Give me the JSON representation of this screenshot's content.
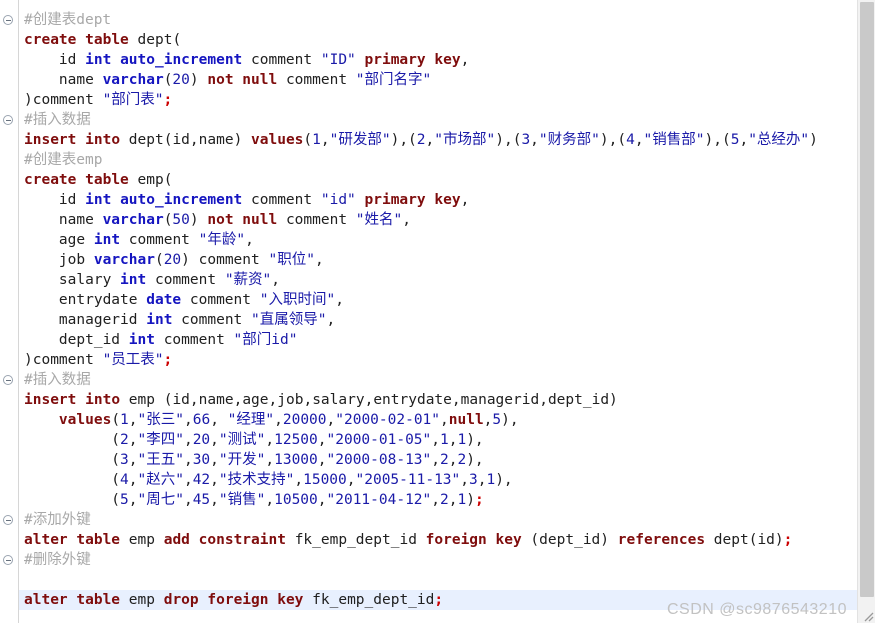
{
  "editor": {
    "language": "sql",
    "highlighted_line_index": 29,
    "colors": {
      "keyword": "#7f0d0d",
      "type": "#1515c0",
      "string": "#1a1aa8",
      "number": "#1a1aa8",
      "semicolon": "#cc0000",
      "comment": "#a8a8a8",
      "plain": "#202020",
      "current_line_bg": "#e8f0fe",
      "background": "#ffffff"
    }
  },
  "lines": [
    {
      "fold": true,
      "text": "#创建表dept"
    },
    {
      "fold": false,
      "text": "create table dept("
    },
    {
      "fold": false,
      "text": "    id int auto_increment comment \"ID\" primary key,"
    },
    {
      "fold": false,
      "text": "    name varchar(20) not null comment \"部门名字\""
    },
    {
      "fold": false,
      "text": ")comment \"部门表\";"
    },
    {
      "fold": true,
      "text": "#插入数据"
    },
    {
      "fold": false,
      "text": "insert into dept(id,name) values(1,\"研发部\"),(2,\"市场部\"),(3,\"财务部\"),(4,\"销售部\"),(5,\"总经办\")"
    },
    {
      "fold": false,
      "text": "#创建表emp"
    },
    {
      "fold": false,
      "text": "create table emp("
    },
    {
      "fold": false,
      "text": "    id int auto_increment comment \"id\" primary key,"
    },
    {
      "fold": false,
      "text": "    name varchar(50) not null comment \"姓名\","
    },
    {
      "fold": false,
      "text": "    age int comment \"年龄\","
    },
    {
      "fold": false,
      "text": "    job varchar(20) comment \"职位\","
    },
    {
      "fold": false,
      "text": "    salary int comment \"薪资\","
    },
    {
      "fold": false,
      "text": "    entrydate date comment \"入职时间\","
    },
    {
      "fold": false,
      "text": "    managerid int comment \"直属领导\","
    },
    {
      "fold": false,
      "text": "    dept_id int comment \"部门id\""
    },
    {
      "fold": false,
      "text": ")comment \"员工表\";"
    },
    {
      "fold": true,
      "text": "#插入数据"
    },
    {
      "fold": false,
      "text": "insert into emp (id,name,age,job,salary,entrydate,managerid,dept_id)"
    },
    {
      "fold": false,
      "text": "    values(1,\"张三\",66, \"经理\",20000,\"2000-02-01\",null,5),"
    },
    {
      "fold": false,
      "text": "          (2,\"李四\",20,\"测试\",12500,\"2000-01-05\",1,1),"
    },
    {
      "fold": false,
      "text": "          (3,\"王五\",30,\"开发\",13000,\"2000-08-13\",2,2),"
    },
    {
      "fold": false,
      "text": "          (4,\"赵六\",42,\"技术支持\",15000,\"2005-11-13\",3,1),"
    },
    {
      "fold": false,
      "text": "          (5,\"周七\",45,\"销售\",10500,\"2011-04-12\",2,1);"
    },
    {
      "fold": true,
      "text": "#添加外键"
    },
    {
      "fold": false,
      "text": "alter table emp add constraint fk_emp_dept_id foreign key (dept_id) references dept(id);"
    },
    {
      "fold": true,
      "text": "#删除外键"
    },
    {
      "fold": false,
      "text": ""
    },
    {
      "fold": false,
      "text": "alter table emp drop foreign key fk_emp_dept_id;"
    }
  ],
  "watermark": {
    "text": "CSDN @sc9876543210"
  },
  "scrollbar": {
    "orientation": "vertical",
    "thumb_position": "top"
  }
}
